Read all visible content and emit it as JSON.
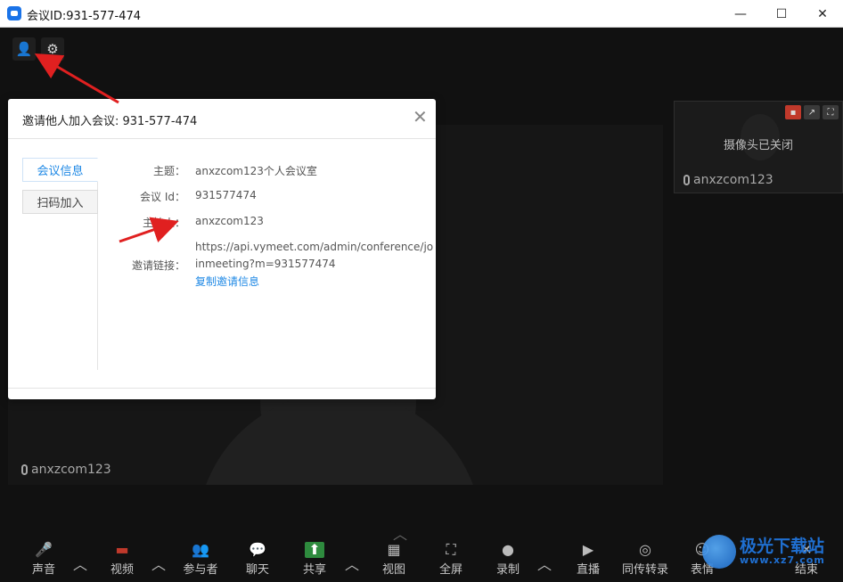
{
  "window": {
    "title": "会议ID:931-577-474",
    "minimize": "—",
    "maximize": "☐",
    "close": "✕"
  },
  "top_tools": [
    {
      "icon": "add-user-icon",
      "glyph": "👤"
    },
    {
      "icon": "gear-icon",
      "glyph": "⚙"
    }
  ],
  "dialog": {
    "title": "邀请他人加入会议: 931-577-474",
    "close_glyph": "✕",
    "tabs": [
      "会议信息",
      "扫码加入"
    ],
    "active_tab": 0,
    "topic_label": "主题：",
    "topic_value": "anxzcom123个人会议室",
    "id_label": "会议 Id：",
    "id_value": "931577474",
    "host_label": "主持人：",
    "host_value": "anxzcom123",
    "link_label": "邀请链接：",
    "link_line1": "https://api.vymeet.com/admin/conference/jo",
    "link_line2": "inmeeting?m=931577474",
    "copy_link": "复制邀请信息"
  },
  "thumbnail": {
    "status": "摄像头已关闭",
    "name": "anxzcom123"
  },
  "main_video": {
    "name": "anxzcom123"
  },
  "toolbar": {
    "items": [
      {
        "label": "声音",
        "icon": "microphone-icon",
        "glyph": "🎤"
      },
      {
        "label": "视频",
        "icon": "video-off-icon",
        "glyph": "▬"
      },
      {
        "label": "参与者",
        "icon": "participants-icon",
        "glyph": "👥"
      },
      {
        "label": "聊天",
        "icon": "chat-icon",
        "glyph": "💬"
      },
      {
        "label": "共享",
        "icon": "share-icon",
        "glyph": "⬆"
      },
      {
        "label": "视图",
        "icon": "layout-icon",
        "glyph": "▦"
      },
      {
        "label": "全屏",
        "icon": "fullscreen-icon",
        "glyph": "⛶"
      },
      {
        "label": "录制",
        "icon": "record-icon",
        "glyph": "●"
      },
      {
        "label": "直播",
        "icon": "live-icon",
        "glyph": "▶"
      },
      {
        "label": "同传转录",
        "icon": "transcription-icon",
        "glyph": "◎"
      },
      {
        "label": "表情",
        "icon": "emoji-icon",
        "glyph": "☺"
      },
      {
        "label": "结束",
        "icon": "end-icon",
        "glyph": "✕"
      }
    ]
  },
  "watermark": {
    "line1": "极光下载站",
    "line2": "www.xz7.com"
  },
  "colors": {
    "accent": "#1e88e5",
    "share_green": "#2e8b3e",
    "arrow_red": "#e02020"
  }
}
